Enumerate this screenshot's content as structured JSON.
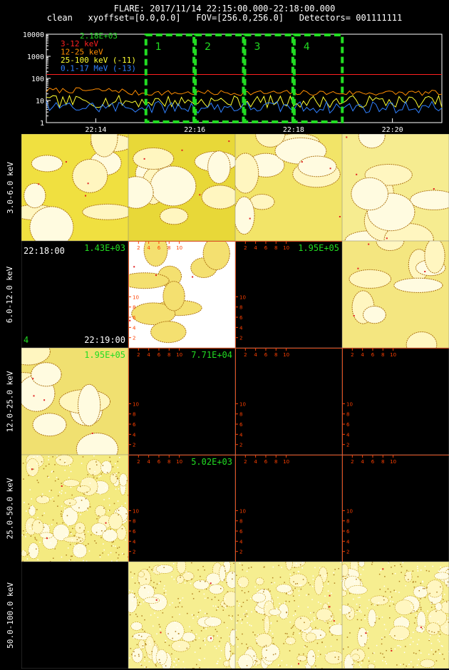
{
  "header": {
    "line1": "FLARE: 2017/11/14 22:15:00.000-22:18:00.000",
    "line2": "clean   xyoffset=[0.0,0.0]   FOV=[256.0,256.0]   Detectors= 001111111"
  },
  "chart_data": [
    {
      "type": "line",
      "scale": "log",
      "ylim": [
        1,
        10000
      ],
      "y_ticks": [
        "10000",
        "1000",
        "100",
        "10",
        "1"
      ],
      "x_ticks": [
        "22:14",
        "22:16",
        "22:18",
        "22:20"
      ],
      "x_range": [
        "22:13:00",
        "22:21:00"
      ],
      "legend_placement": "top-left",
      "legend_top": "2.18E+03",
      "series": [
        {
          "name": "3-12 keV",
          "color": "#ff2020",
          "level": 150
        },
        {
          "name": "12-25 keV",
          "color": "#ff8c00",
          "level": 22
        },
        {
          "name": "25-100 keV (-11)",
          "color": "#ffff30",
          "level": 9
        },
        {
          "name": "0.1-17 MeV (-13)",
          "color": "#3080ff",
          "level": 5
        }
      ],
      "intervals": [
        {
          "label": "1",
          "start": "22:15:00",
          "end": "22:16:00"
        },
        {
          "label": "2",
          "start": "22:16:00",
          "end": "22:17:00"
        },
        {
          "label": "3",
          "start": "22:17:00",
          "end": "22:18:00"
        },
        {
          "label": "4",
          "start": "22:18:00",
          "end": "22:19:00"
        }
      ],
      "interval_color": "#22dd22"
    },
    {
      "type": "heatmap",
      "row_labels": [
        "3.0-6.0 keV",
        "6.0-12.0 keV",
        "12.0-25.0 keV",
        "25.0-50.0 keV",
        "50.0-100.0 keV"
      ],
      "axis_ticks": [
        "2",
        "4",
        "6",
        "8",
        "10"
      ],
      "cells": [
        {
          "row": 0,
          "col": 0,
          "kind": "blob",
          "seed": 11,
          "bg": "#f0e040"
        },
        {
          "row": 0,
          "col": 1,
          "kind": "blob",
          "seed": 23,
          "bg": "#e8d838"
        },
        {
          "row": 0,
          "col": 2,
          "kind": "blob",
          "seed": 37,
          "bg": "#f2e468"
        },
        {
          "row": 0,
          "col": 3,
          "kind": "blob",
          "seed": 41,
          "bg": "#f6ec90"
        },
        {
          "row": 1,
          "col": 0,
          "kind": "black",
          "label_tr": "1.43E+03",
          "label_tl": "22:18:00",
          "label_bl": "4",
          "label_br": "22:19:00"
        },
        {
          "row": 1,
          "col": 1,
          "kind": "white",
          "seed": 53,
          "axis": true
        },
        {
          "row": 1,
          "col": 2,
          "kind": "black",
          "label_tr": "1.95E+05",
          "axis": true
        },
        {
          "row": 1,
          "col": 3,
          "kind": "blob",
          "seed": 67,
          "bg": "#f4e680"
        },
        {
          "row": 2,
          "col": 0,
          "kind": "blob",
          "seed": 71,
          "bg": "#f0e070",
          "label_tr": "1.95E+05"
        },
        {
          "row": 2,
          "col": 1,
          "kind": "black",
          "label_tr": "7.71E+04",
          "axis": true
        },
        {
          "row": 2,
          "col": 2,
          "kind": "black",
          "axis": true
        },
        {
          "row": 2,
          "col": 3,
          "kind": "black",
          "axis": true
        },
        {
          "row": 3,
          "col": 0,
          "kind": "noisy",
          "seed": 83,
          "bg": "#f4ea80"
        },
        {
          "row": 3,
          "col": 1,
          "kind": "black",
          "label_tr": "5.02E+03",
          "axis": true
        },
        {
          "row": 3,
          "col": 2,
          "kind": "black",
          "axis": true
        },
        {
          "row": 3,
          "col": 3,
          "kind": "black",
          "axis": true
        },
        {
          "row": 4,
          "col": 0,
          "kind": "black"
        },
        {
          "row": 4,
          "col": 1,
          "kind": "noisy",
          "seed": 97,
          "bg": "#f6ee90"
        },
        {
          "row": 4,
          "col": 2,
          "kind": "noisy",
          "seed": 101,
          "bg": "#f6ee90"
        },
        {
          "row": 4,
          "col": 3,
          "kind": "noisy",
          "seed": 113,
          "bg": "#f6ee90"
        }
      ]
    }
  ]
}
